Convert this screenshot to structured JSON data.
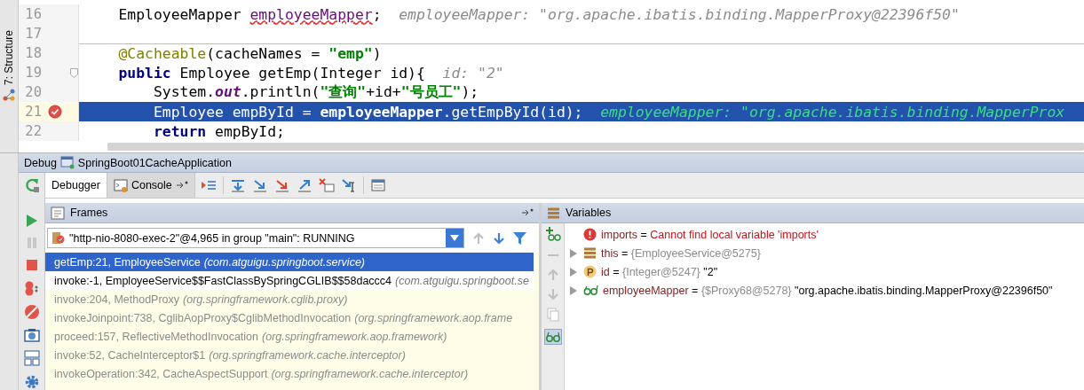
{
  "tool_strip": {
    "label": "7: Structure"
  },
  "editor": {
    "lines": [
      {
        "number": "16",
        "breakpoint": false,
        "current": false,
        "fold": false,
        "separator_above": false,
        "segments": [
          {
            "kind": "plain",
            "text": "    EmployeeMapper "
          },
          {
            "kind": "unresolved",
            "text": "employeeMapper"
          },
          {
            "kind": "plain",
            "text": ";"
          }
        ],
        "hint": "employeeMapper: \"org.apache.ibatis.binding.MapperProxy@22396f50\""
      },
      {
        "number": "17",
        "breakpoint": false,
        "current": false,
        "fold": false,
        "separator_above": false
      },
      {
        "number": "18",
        "breakpoint": false,
        "current": false,
        "fold": false,
        "separator_above": true,
        "segments": [
          {
            "kind": "annotation",
            "text": "    @Cacheable"
          },
          {
            "kind": "plain",
            "text": "(cacheNames = "
          },
          {
            "kind": "string",
            "text": "\"emp\""
          },
          {
            "kind": "plain",
            "text": ")"
          }
        ]
      },
      {
        "number": "19",
        "breakpoint": false,
        "current": false,
        "fold": true,
        "separator_above": false,
        "segments": [
          {
            "kind": "keyword",
            "text": "    public"
          },
          {
            "kind": "plain",
            "text": " Employee getEmp(Integer id){"
          }
        ],
        "hint": "id: \"2\""
      },
      {
        "number": "20",
        "breakpoint": false,
        "current": false,
        "fold": false,
        "separator_above": false,
        "segments": [
          {
            "kind": "plain",
            "text": "        System."
          },
          {
            "kind": "static",
            "text": "out"
          },
          {
            "kind": "plain",
            "text": ".println("
          },
          {
            "kind": "string",
            "text": "\"查询\""
          },
          {
            "kind": "plain",
            "text": "+id+"
          },
          {
            "kind": "string",
            "text": "\"号员工\""
          },
          {
            "kind": "plain",
            "text": ");"
          }
        ]
      },
      {
        "number": "21",
        "breakpoint": true,
        "current": true,
        "fold": false,
        "separator_above": false,
        "segments": [
          {
            "kind": "plain",
            "text": "        Employee empById = "
          },
          {
            "kind": "bold",
            "text": "employeeMapper"
          },
          {
            "kind": "plain",
            "text": ".getEmpById(id);"
          }
        ],
        "hint": "employeeMapper: \"org.apache.ibatis.binding.MapperProx"
      },
      {
        "number": "22",
        "breakpoint": false,
        "current": false,
        "fold": false,
        "separator_above": false,
        "segments": [
          {
            "kind": "keyword",
            "text": "        return"
          },
          {
            "kind": "plain",
            "text": " empById;"
          }
        ]
      }
    ]
  },
  "debug": {
    "title": "Debug",
    "configuration": "SpringBoot01CacheApplication",
    "tabs": [
      {
        "label": "Debugger",
        "selected": true
      },
      {
        "label": "Console",
        "selected": false
      }
    ],
    "frames": {
      "title": "Frames",
      "thread": "\"http-nio-8080-exec-2\"@4,965 in group \"main\": RUNNING",
      "items": [
        {
          "method": "getEmp:21, EmployeeService",
          "package": "(com.atguigu.springboot.service)",
          "selected": true,
          "library": false
        },
        {
          "method": "invoke:-1, EmployeeService$$FastClassBySpringCGLIB$$58daccc4",
          "package": "(com.atguigu.springboot.se",
          "selected": false,
          "library": false
        },
        {
          "method": "invoke:204, MethodProxy",
          "package": "(org.springframework.cglib.proxy)",
          "selected": false,
          "library": true
        },
        {
          "method": "invokeJoinpoint:738, CglibAopProxy$CglibMethodInvocation",
          "package": "(org.springframework.aop.frame",
          "selected": false,
          "library": true
        },
        {
          "method": "proceed:157, ReflectiveMethodInvocation",
          "package": "(org.springframework.aop.framework)",
          "selected": false,
          "library": true
        },
        {
          "method": "invoke:52, CacheInterceptor$1",
          "package": "(org.springframework.cache.interceptor)",
          "selected": false,
          "library": true
        },
        {
          "method": "invokeOperation:342, CacheAspectSupport",
          "package": "(org.springframework.cache.interceptor)",
          "selected": false,
          "library": true
        }
      ]
    },
    "variables": {
      "title": "Variables",
      "items": [
        {
          "kind": "error",
          "name": "imports",
          "equals": "=",
          "message": "Cannot find local variable 'imports'",
          "expandable": false
        },
        {
          "kind": "field",
          "name": "this",
          "equals": "=",
          "type_ref": "{EmployeeService@5275}",
          "expandable": true
        },
        {
          "kind": "param",
          "name": "id",
          "equals": "=",
          "type_ref": "{Integer@5247}",
          "value": "\"2\"",
          "expandable": true
        },
        {
          "kind": "watch",
          "name": "employeeMapper",
          "equals": "=",
          "type_ref": "{$Proxy68@5278}",
          "value": "\"org.apache.ibatis.binding.MapperProxy@22396f50\"",
          "expandable": true
        }
      ]
    }
  }
}
